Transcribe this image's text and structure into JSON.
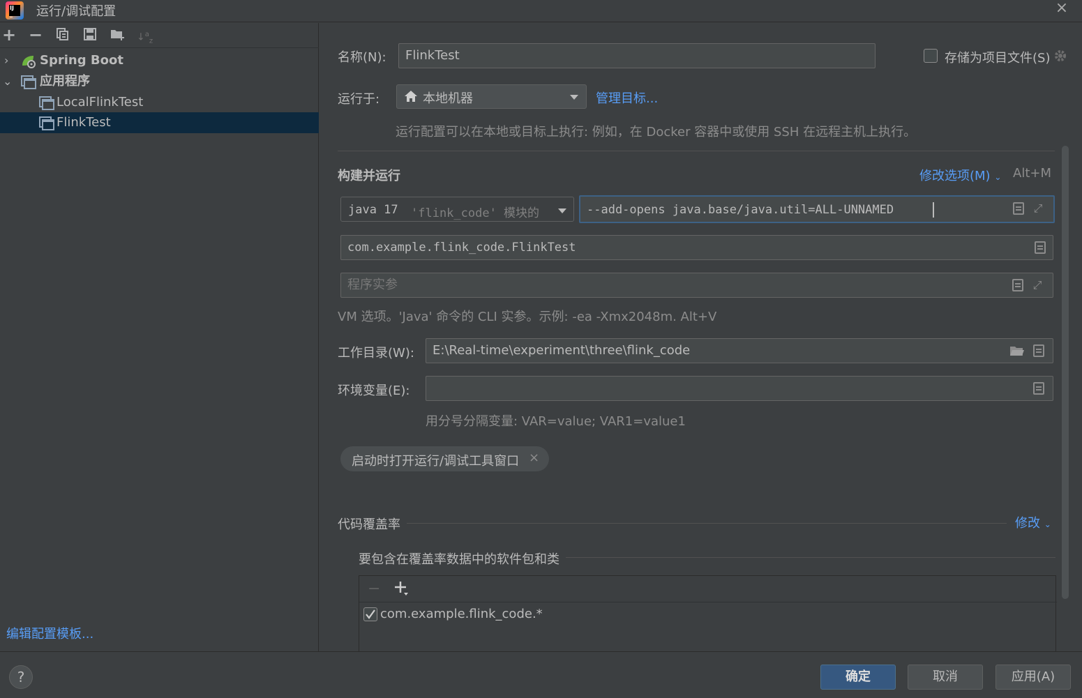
{
  "window": {
    "title": "运行/调试配置",
    "close_icon": "×"
  },
  "toolbar": {
    "add": "+",
    "remove": "−",
    "copy": "⧉",
    "save": "▭",
    "folder": "▬",
    "sort": "↓"
  },
  "tree": {
    "items": [
      {
        "label": "Spring Boot",
        "expanded": false,
        "bold": true
      },
      {
        "label": "应用程序",
        "expanded": true,
        "bold": true
      },
      {
        "label": "LocalFlinkTest"
      },
      {
        "label": "FlinkTest",
        "selected": true
      }
    ],
    "arrow_collapsed": "›",
    "arrow_expanded": "⌄"
  },
  "edit_templates": "编辑配置模板...",
  "form": {
    "name_label": "名称(N):",
    "name_value": "FlinkTest",
    "store_as_project_file": "存储为项目文件(S)",
    "run_on_label": "运行于:",
    "run_on_value": "本地机器",
    "manage_targets": "管理目标...",
    "run_on_hint": "运行配置可以在本地或目标上执行: 例如，在 Docker 容器中或使用 SSH 在远程主机上执行。",
    "build_run_title": "构建并运行",
    "modify_options": "修改选项(M)",
    "modify_shortcut": "Alt+M",
    "jdk_value": "java 17",
    "jdk_module": "'flink_code' 模块的",
    "vm_options_value": "--add-opens java.base/java.util=ALL-UNNAMED",
    "main_class_value": "com.example.flink_code.FlinkTest",
    "program_args_placeholder": "程序实参",
    "vm_hint": "VM 选项。'Java' 命令的 CLI 实参。示例: -ea -Xmx2048m. Alt+V",
    "workdir_label": "工作目录(W):",
    "workdir_value": "E:\\Real-time\\experiment\\three\\flink_code",
    "env_label": "环境变量(E):",
    "env_value": "",
    "env_hint": "用分号分隔变量: VAR=value; VAR1=value1",
    "open_tool_window_chip": "启动时打开运行/调试工具窗口",
    "coverage_title": "代码覆盖率",
    "coverage_modify": "修改",
    "coverage_include_label": "要包含在覆盖率数据中的软件包和类",
    "coverage_item": "com.example.flink_code.*",
    "coverage_item_checked": true
  },
  "footer": {
    "help": "?",
    "ok": "确定",
    "cancel": "取消",
    "apply": "应用(A)"
  },
  "colors": {
    "background": "#3c3f41",
    "field_bg": "#45494a",
    "selection": "#0d293e",
    "link": "#589df6",
    "focus_border": "#3d6185",
    "primary_button": "#365880"
  }
}
